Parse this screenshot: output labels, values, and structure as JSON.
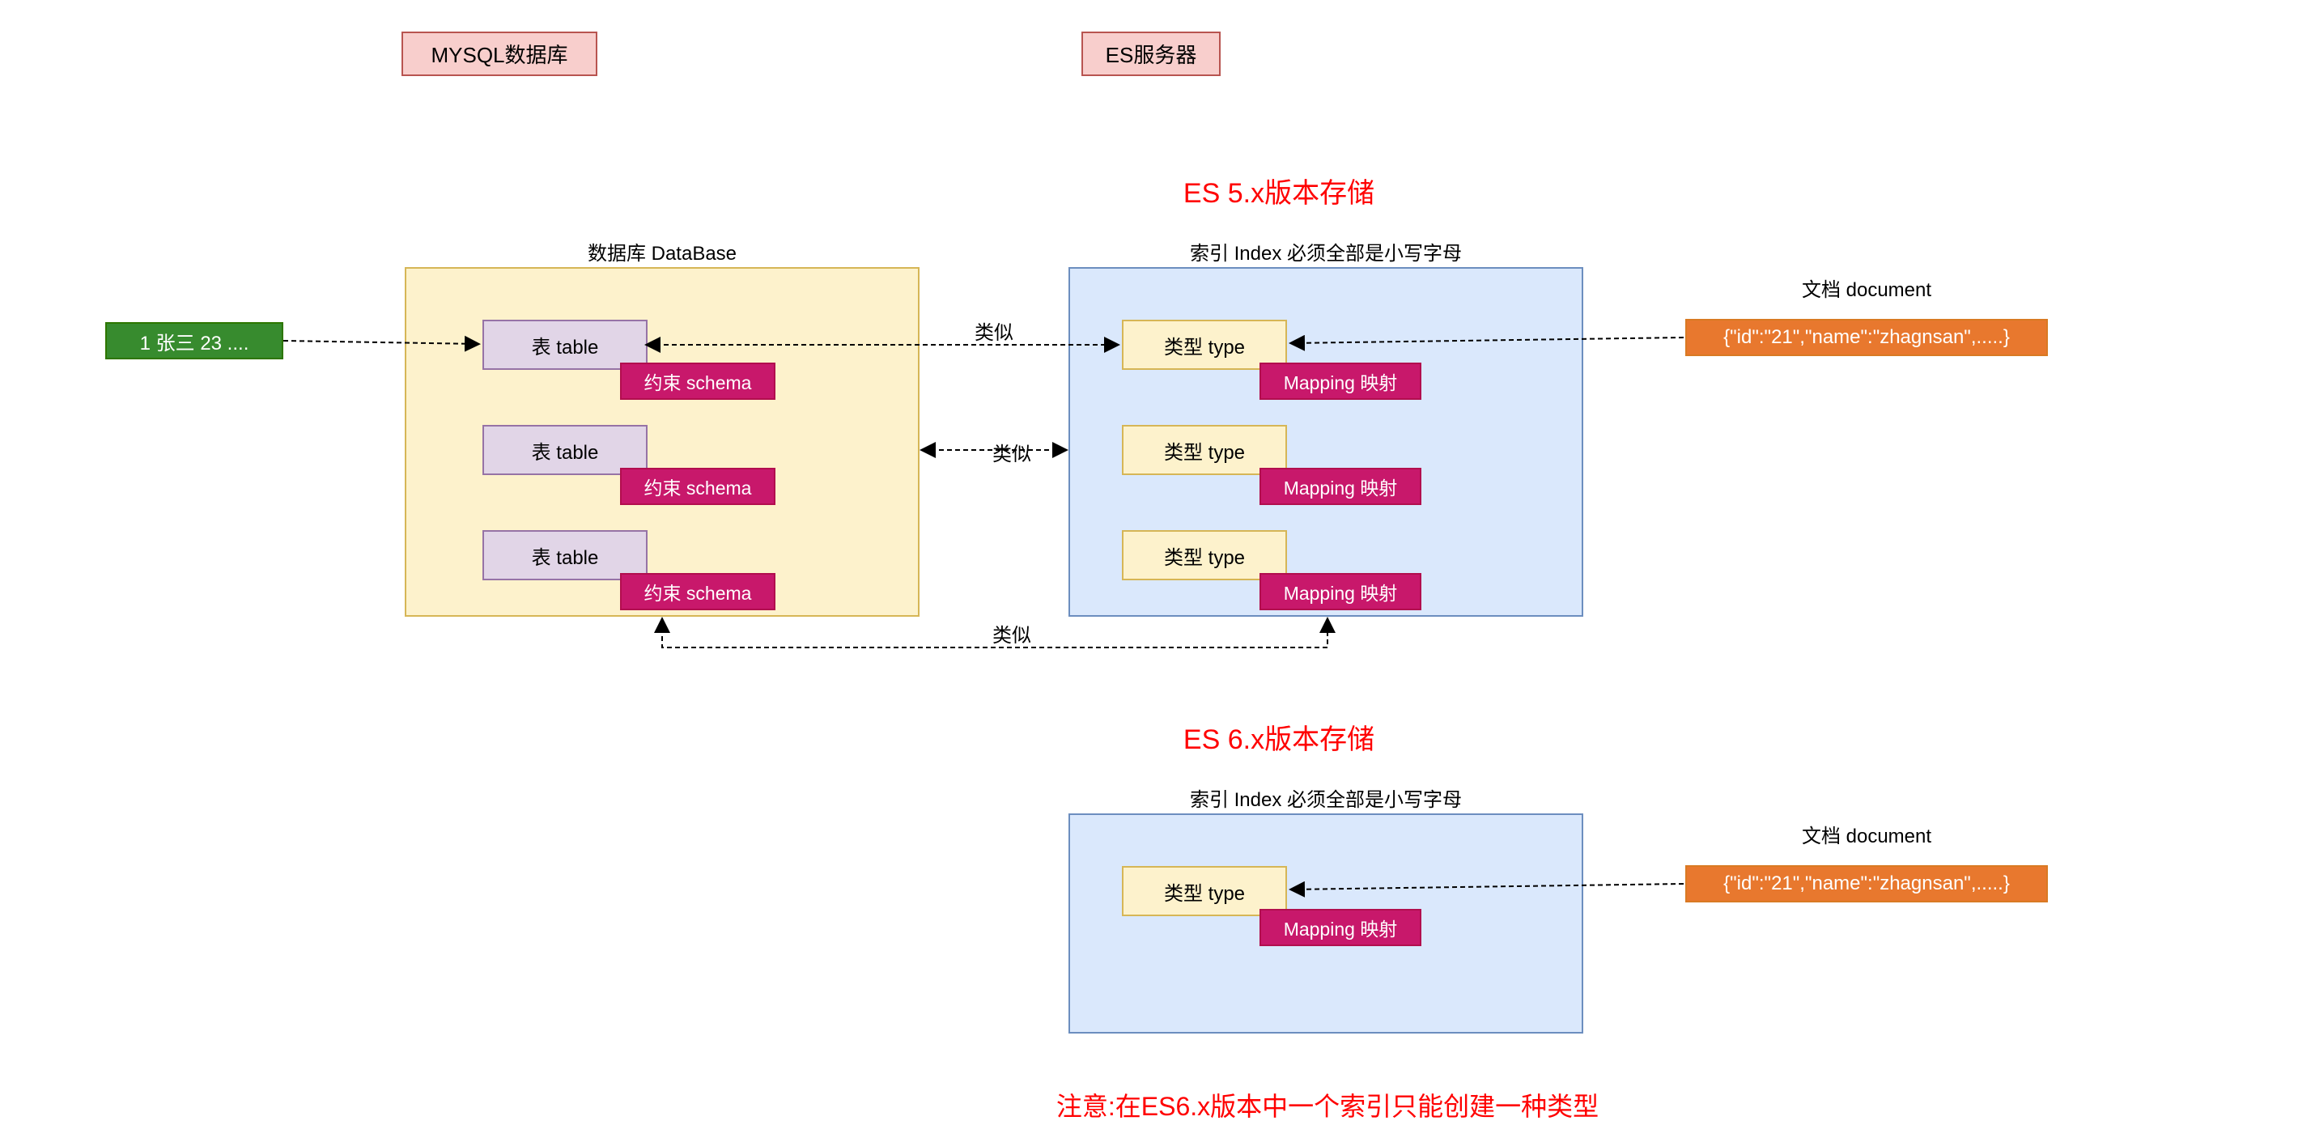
{
  "headers": {
    "mysql": "MYSQL数据库",
    "es": "ES服务器"
  },
  "titles": {
    "es5": "ES 5.x版本存储",
    "es6": "ES 6.x版本存储",
    "note": "注意:在ES6.x版本中一个索引只能创建一种类型"
  },
  "labels": {
    "database": "数据库 DataBase",
    "index": "索引 Index 必须全部是小写字母",
    "document": "文档 document",
    "similar": "类似"
  },
  "boxes": {
    "table": "表 table",
    "schema": "约束 schema",
    "type": "类型 type",
    "mapping": "Mapping 映射",
    "row": "1 张三 23 ....",
    "doc": "{\"id\":\"21\",\"name\":\"zhagnsan\",.....}"
  }
}
